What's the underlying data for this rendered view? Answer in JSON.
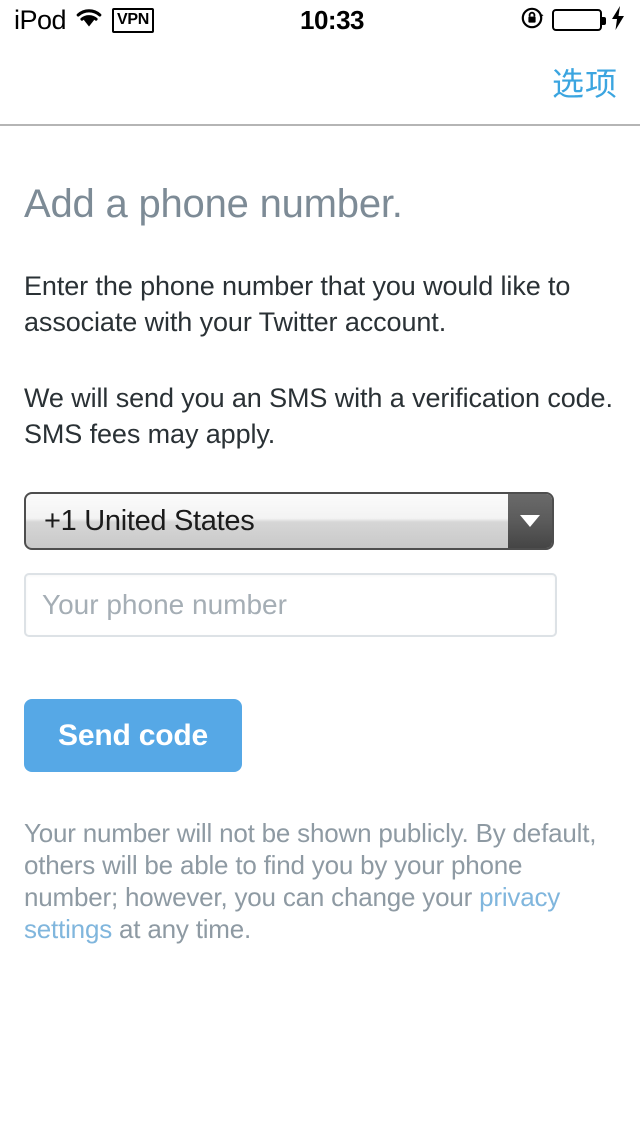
{
  "status_bar": {
    "carrier": "iPod",
    "wifi_icon": "wifi-icon",
    "vpn_label": "VPN",
    "time": "10:33",
    "rotation_lock_icon": "rotation-lock-icon",
    "battery_icon": "battery-full-icon",
    "battery_color": "#3ad63a",
    "charging_icon": "lightning-bolt-icon"
  },
  "nav_bar": {
    "action_label": "选项",
    "action_color": "#3ba5e0"
  },
  "main": {
    "heading": "Add a phone number.",
    "paragraph_1": "Enter the phone number that you would like to associate with your Twitter account.",
    "paragraph_2": "We will send you an SMS with a verification code. SMS fees may apply.",
    "country_select": {
      "selected": "+1 United States",
      "caret_icon": "chevron-down-icon"
    },
    "phone_field": {
      "value": "",
      "placeholder": "Your phone number"
    },
    "send_button": {
      "label": "Send code",
      "color": "#56a8e6"
    },
    "footer_note": {
      "part_1": "Your number will not be shown publicly. By default, others will be able to find you by your phone number; however, you can change your ",
      "link_text": "privacy settings",
      "part_2": " at any time.",
      "link_color": "#80b6dd"
    }
  }
}
